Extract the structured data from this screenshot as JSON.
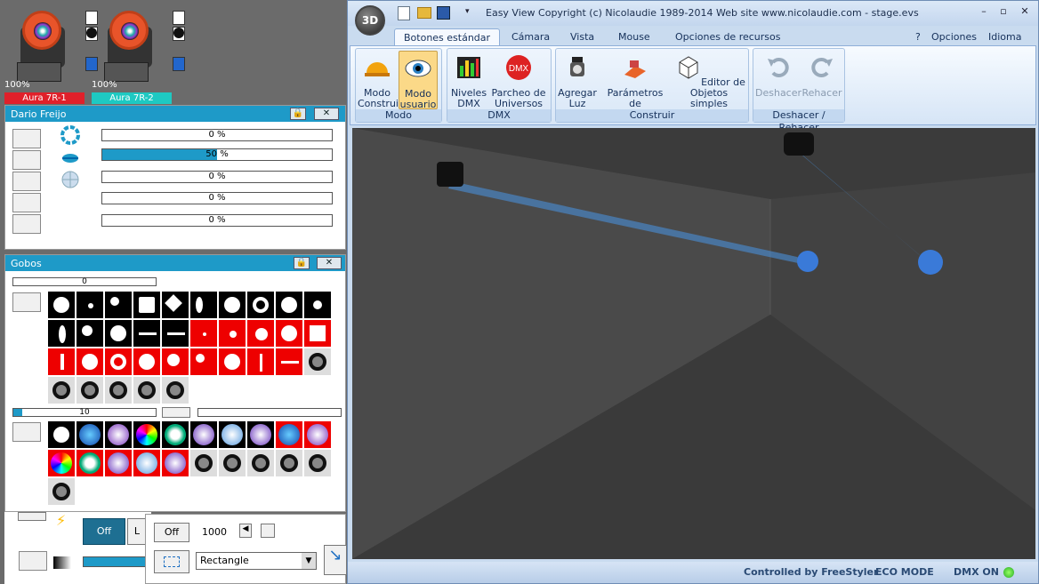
{
  "fixtures": [
    {
      "percent": "100%",
      "name": "Aura 7R-1",
      "color": "#e0202a"
    },
    {
      "percent": "100%",
      "name": "Aura 7R-2",
      "color": "#1ec9c2"
    }
  ],
  "dario": {
    "title": "Dario Freijo",
    "lock": "🔒",
    "close": "✕",
    "bars": [
      {
        "label": "0 %",
        "value": 0
      },
      {
        "label": "50 %",
        "value": 0.5
      },
      {
        "label": "0 %",
        "value": 0
      },
      {
        "label": "0 %",
        "value": 0
      },
      {
        "label": "0 %",
        "value": 0
      }
    ]
  },
  "gobos": {
    "title": "Gobos",
    "lock": "🔒",
    "close": "✕",
    "slider1": "0",
    "slider2": "10"
  },
  "lower": {
    "off": "Off",
    "value": "1000",
    "off2": "Off",
    "shape": "Rectangle",
    "partial_l": "L"
  },
  "app": {
    "orb": "3D",
    "title": "Easy View   Copyright (c) Nicolaudie 1989-2014    Web site www.nicolaudie.com - stage.evs",
    "minimize": "–",
    "maximize": "▫",
    "close": "✕",
    "help": "?",
    "opciones": "Opciones",
    "idioma": "Idioma"
  },
  "tabs": [
    "Botones estándar",
    "Cámara",
    "Vista",
    "Mouse",
    "Opciones de recursos"
  ],
  "groups": {
    "modo": "Modo",
    "dmx": "DMX",
    "construir": "Construir",
    "deshacer": "Deshacer / Rehacer"
  },
  "buttons": {
    "construir": "Modo Construir",
    "usuario": "Modo usuario",
    "niveles": "Niveles DMX",
    "parcheo": "Parcheo de Universos",
    "agregar": "Agregar Luz",
    "parametros": "Parámetros de escenario...",
    "editor": "Editor de Objetos simples",
    "deshacer": "Deshacer",
    "rehacer": "Rehacer"
  },
  "status": {
    "controlled": "Controlled by FreeStyler",
    "eco": "ECO MODE",
    "dmx": "DMX ON"
  }
}
